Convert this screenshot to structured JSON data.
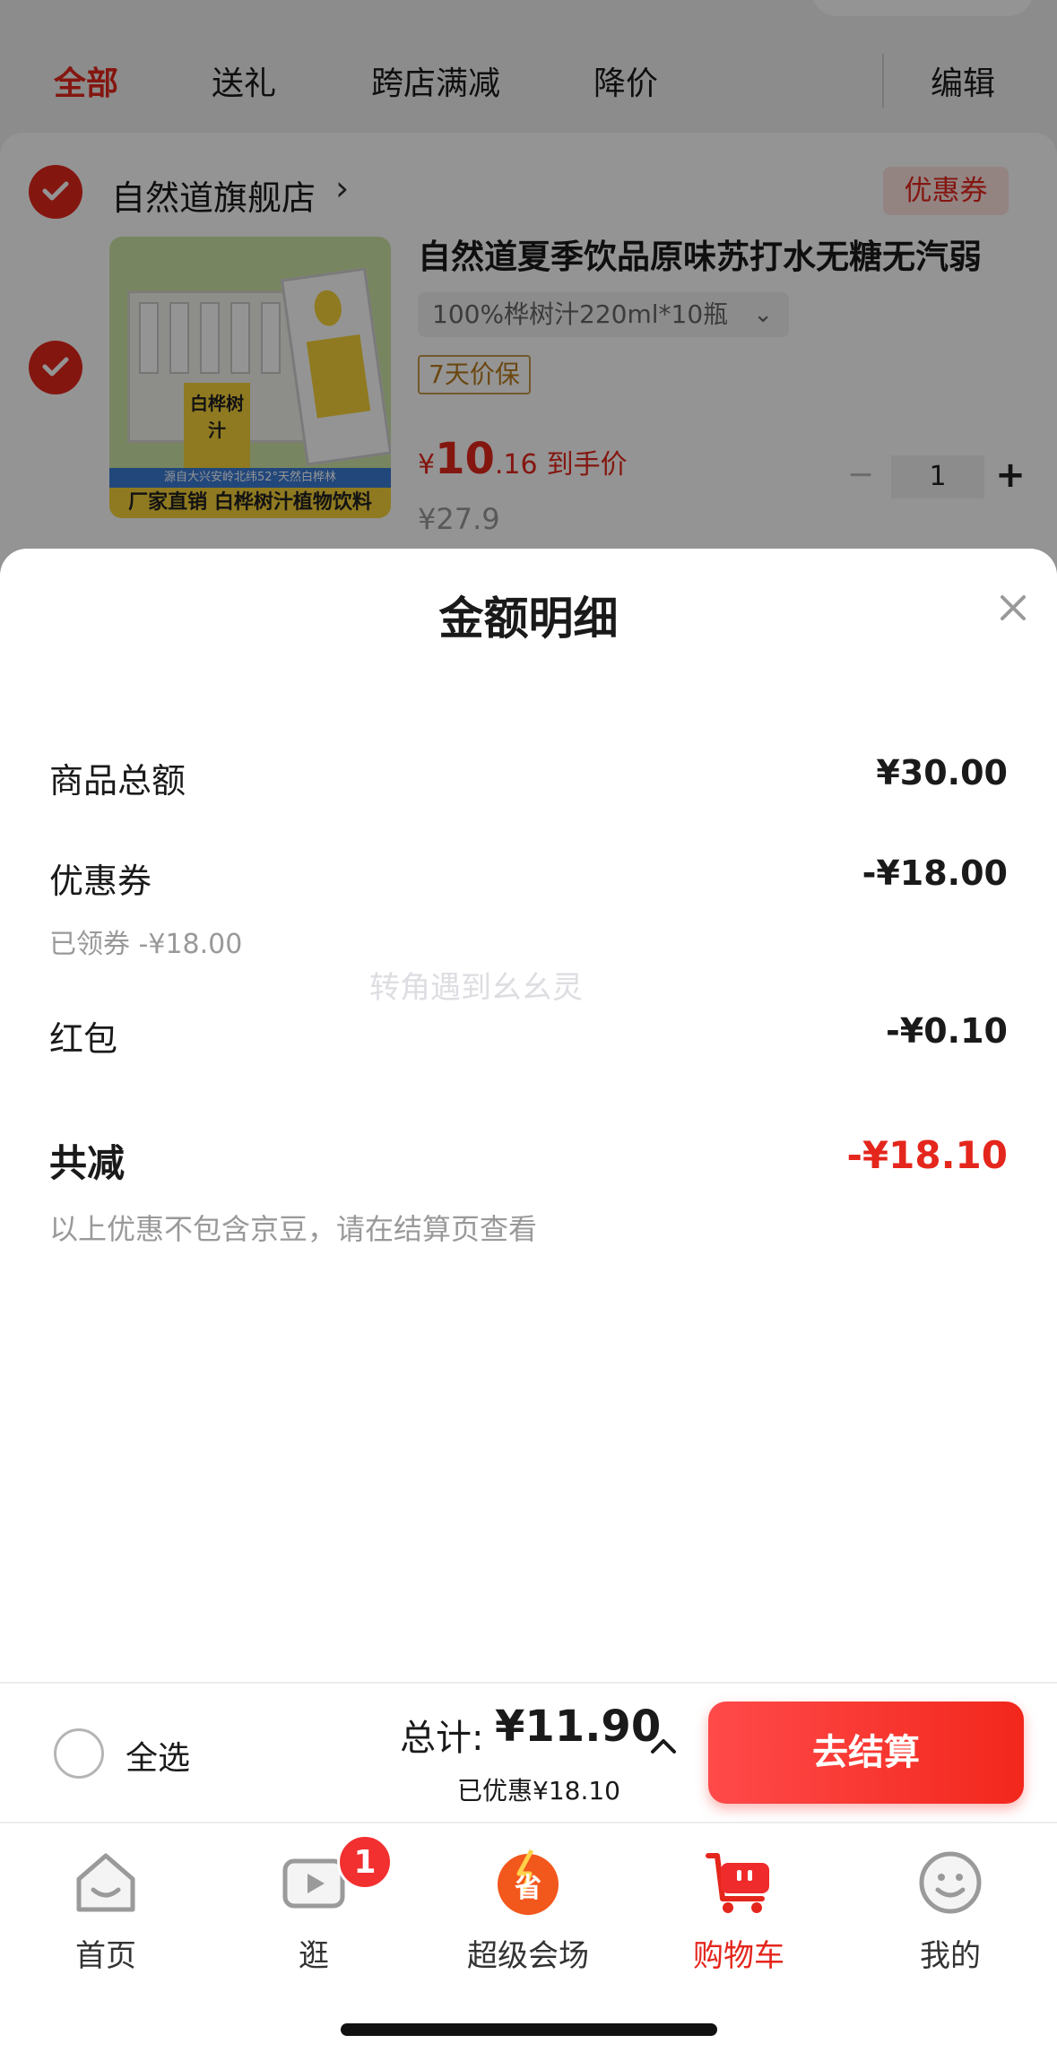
{
  "tabs": [
    {
      "label": "全部",
      "active": true
    },
    {
      "label": "送礼",
      "active": false
    },
    {
      "label": "跨店满减",
      "active": false
    },
    {
      "label": "降价",
      "active": false
    }
  ],
  "edit_label": "编辑",
  "store": {
    "name": "自然道旗舰店",
    "arrow": "›",
    "coupon_badge": "优惠券"
  },
  "product": {
    "image_texts": {
      "box_label": "白桦树汁",
      "strip": "源自大兴安岭北纬52°天然白桦林",
      "banner": "厂家直销 白桦树汁植物饮料"
    },
    "title": "自然道夏季饮品原味苏打水无糖无汽弱",
    "variant": "100%桦树汁220ml*10瓶",
    "guarantee": "7天价保",
    "price_symbol": "¥",
    "price_int": "10",
    "price_dec": ".16",
    "price_note": "到手价",
    "original_price": "¥27.9",
    "quantity": "1",
    "minus": "−",
    "plus": "+"
  },
  "sheet": {
    "title": "金额明细",
    "rows": [
      {
        "label": "商品总额",
        "value": "¥30.00"
      },
      {
        "label": "优惠券",
        "value": "-¥18.00",
        "sub": "已领券 -¥18.00"
      },
      {
        "label": "红包",
        "value": "-¥0.10"
      }
    ],
    "watermark": "转角遇到幺幺灵",
    "total_label": "共减",
    "total_value": "-¥18.10",
    "note": "以上优惠不包含京豆，请在结算页查看"
  },
  "checkout": {
    "select_all": "全选",
    "sum_label": "总计:",
    "sum_value": "¥11.90",
    "saved": "已优惠¥18.10",
    "button": "去结算"
  },
  "nav": [
    {
      "label": "首页",
      "icon": "home-icon",
      "active": false
    },
    {
      "label": "逛",
      "icon": "video-play-icon",
      "active": false,
      "badge": "1"
    },
    {
      "label": "超级会场",
      "icon": "super-venue-icon",
      "active": false,
      "icon_text": "省"
    },
    {
      "label": "购物车",
      "icon": "cart-icon",
      "active": true
    },
    {
      "label": "我的",
      "icon": "profile-icon",
      "active": false
    }
  ],
  "colors": {
    "accent": "#e4261c",
    "checkout_button": "#f2271c",
    "guarantee_border": "#c59a4a"
  }
}
